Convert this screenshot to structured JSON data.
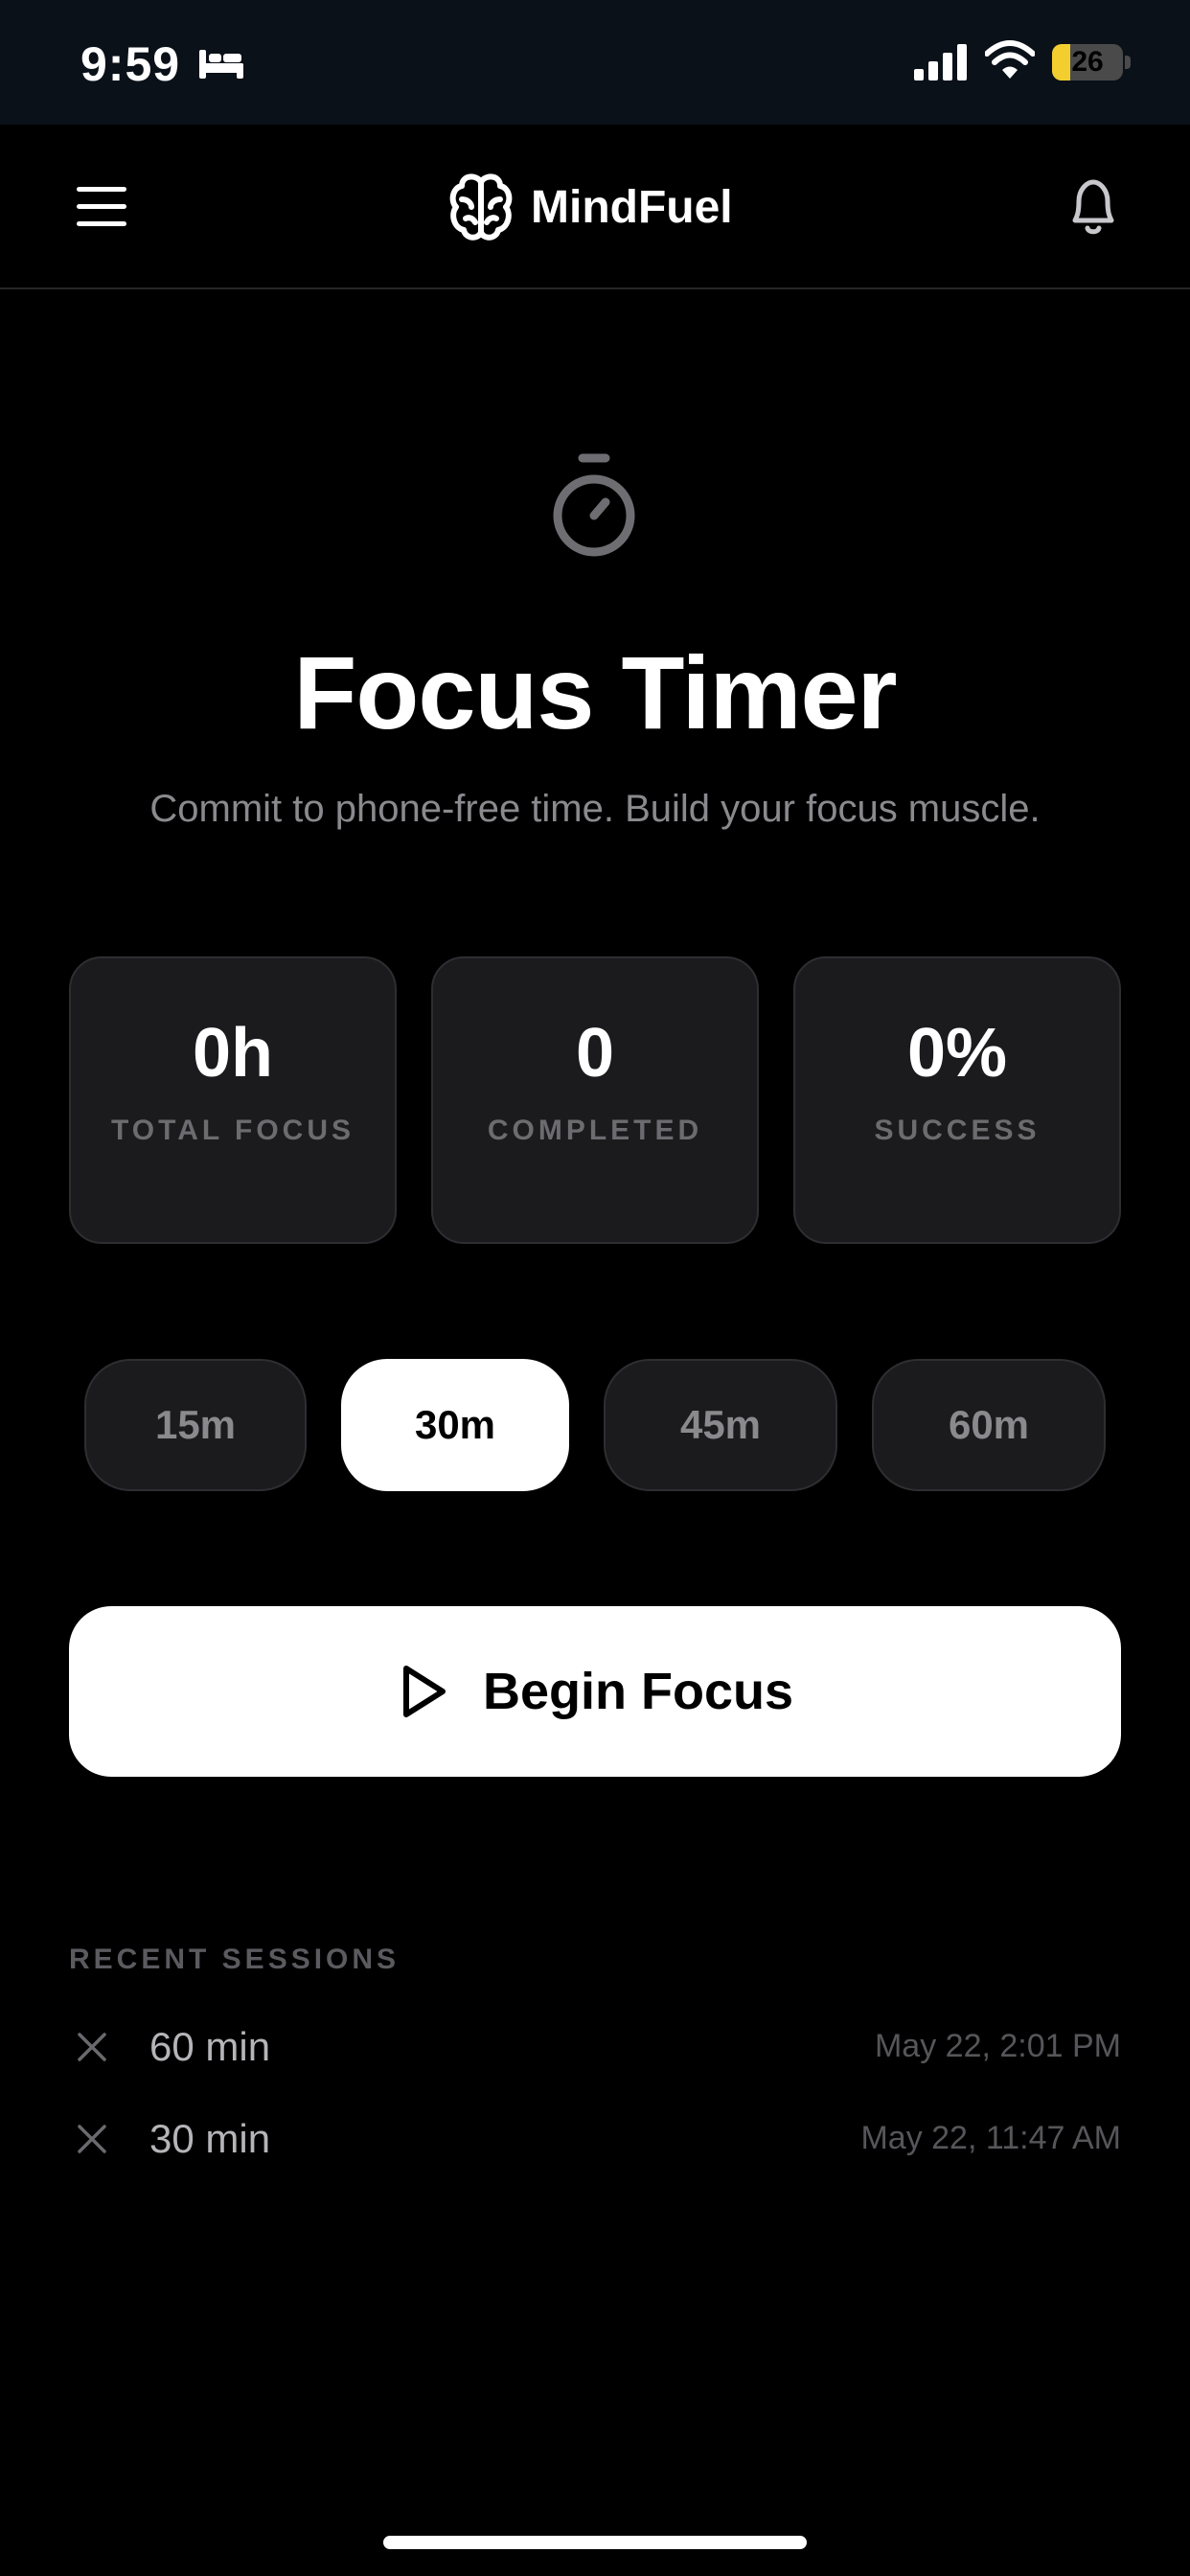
{
  "status_bar": {
    "time": "9:59",
    "battery_level": "26",
    "battery_fraction": 0.26,
    "battery_color": "#f2cf2e"
  },
  "header": {
    "app_title": "MindFuel",
    "icons": [
      "menu-icon",
      "brain-icon",
      "bell-icon"
    ]
  },
  "hero": {
    "icon": "timer-icon",
    "title": "Focus Timer",
    "subtitle": "Commit to phone-free time. Build your focus muscle."
  },
  "stats": [
    {
      "value": "0h",
      "label": "TOTAL FOCUS"
    },
    {
      "value": "0",
      "label": "COMPLETED"
    },
    {
      "value": "0%",
      "label": "SUCCESS"
    }
  ],
  "durations": [
    {
      "label": "15m",
      "selected": false
    },
    {
      "label": "30m",
      "selected": true
    },
    {
      "label": "45m",
      "selected": false
    },
    {
      "label": "60m",
      "selected": false
    }
  ],
  "begin_button": {
    "label": "Begin Focus",
    "icon": "play-icon"
  },
  "recent_sessions": {
    "label": "RECENT SESSIONS",
    "items": [
      {
        "status_icon": "close-icon",
        "duration": "60 min",
        "time": "May 22, 2:01 PM"
      },
      {
        "status_icon": "close-icon",
        "duration": "30 min",
        "time": "May 22, 11:47 AM"
      }
    ]
  }
}
